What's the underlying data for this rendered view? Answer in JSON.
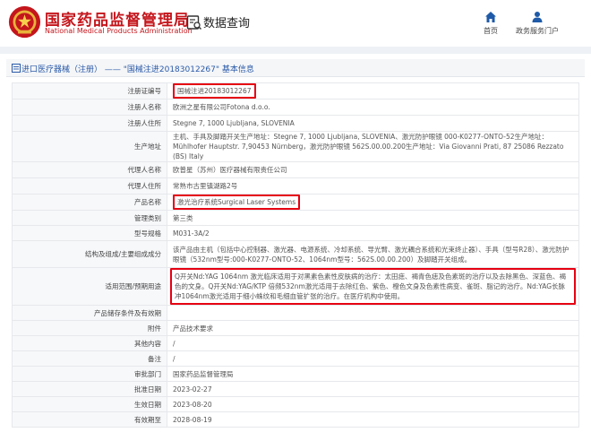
{
  "header": {
    "org_cn": "国家药品监督管理局",
    "org_en": "National Medical Products Administration",
    "db_title": "数据查询",
    "brand_color": "#c4161c",
    "nav": [
      {
        "label": "首页",
        "icon": "home-icon"
      },
      {
        "label": "政务服务门户",
        "icon": "user-icon"
      }
    ]
  },
  "breadcrumb": {
    "text": "进口医疗器械（注册） —— \"国械注进20183012267\" 基本信息"
  },
  "rows": [
    {
      "label": "注册证编号",
      "value": "国械注进20183012267",
      "highlight": true
    },
    {
      "label": "注册人名称",
      "value": "欧洲之星有限公司Fotona d.o.o."
    },
    {
      "label": "注册人住所",
      "value": "Stegne 7, 1000 Ljubljana, SLOVENIA"
    },
    {
      "label": "生产地址",
      "value": "主机、手具及脚踏开关生产地址：Stegne 7, 1000 Ljubljana, SLOVENIA、激光防护眼镜 000-K0277-ONTO-52生产地址：Mühlhofer Hauptstr. 7,90453 Nürnberg，激光防护眼镜 562S.00.00.200生产地址：Via Giovanni Prati, 87 25086 Rezzato (BS) Italy"
    },
    {
      "label": "代理人名称",
      "value": "欧普星（苏州）医疗器械有限责任公司"
    },
    {
      "label": "代理人住所",
      "value": "常熟市古里镇湖路2号"
    },
    {
      "label": "产品名称",
      "value": "激光治疗系统Surgical Laser Systems",
      "highlight": true
    },
    {
      "label": "管理类别",
      "value": "第三类"
    },
    {
      "label": "型号规格",
      "value": "M031-3A/2"
    },
    {
      "label": "结构及组成/主要组成成分",
      "value": "该产品由主机（包括中心控制器、激光器、电源系统、冷却系统、导光臂、激光耦合系统和光束终止器）、手具（型号R28）、激光防护眼镜（532nm型号:000-K0277-ONTO-52、1064nm型号：562S.00.00.200）及脚踏开关组成。"
    },
    {
      "label": "适用范围/预期用途",
      "value": "Q开关Nd:YAG 1064nm 激光临床适用于对黑素色素性皮肤病的治疗：太田痣、褐青色痣及色素斑的治疗以及去除黑色、深蓝色、褐色的文身。Q开关Nd:YAG/KTP 倍频532nm激光适用于去除红色、紫色、橙色文身及色素性病变、雀斑、脂记的治疗。Nd:YAG长脉冲1064nm激光适用于细小蛛纹和毛细血管扩张的治疗。在医疗机构中使用。",
      "highlight_block": true
    },
    {
      "label": "产品储存条件及有效期",
      "value": ""
    },
    {
      "label": "附件",
      "value": "产品技术要求"
    },
    {
      "label": "其他内容",
      "value": "/"
    },
    {
      "label": "备注",
      "value": "/"
    },
    {
      "label": "审批部门",
      "value": "国家药品监督管理局"
    },
    {
      "label": "批准日期",
      "value": "2023-02-27"
    },
    {
      "label": "生效日期",
      "value": "2023-08-20"
    },
    {
      "label": "有效期至",
      "value": "2028-08-19"
    }
  ]
}
